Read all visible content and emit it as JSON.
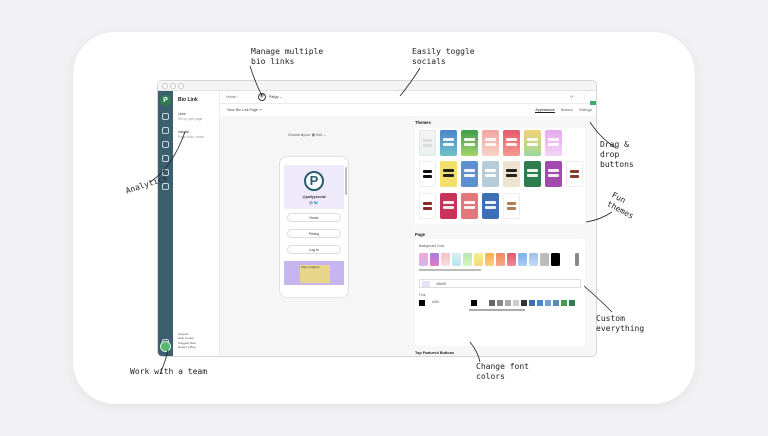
{
  "annotations": {
    "bio_links_l1": "Manage multiple",
    "bio_links_l2": "bio links",
    "socials_l1": "Easily toggle",
    "socials_l2": "socials",
    "analytics": "Analytics",
    "drag_l1": "Drag &",
    "drag_l2": "drop",
    "drag_l3": "buttons",
    "fun_l1": "Fun",
    "fun_l2": "themes",
    "custom_l1": "Custom",
    "custom_l2": "everything",
    "font_l1": "Change font",
    "font_l2": "colors",
    "team": "Work with a team"
  },
  "sidebar": {
    "brand": "Bio Link",
    "links_title": "Links",
    "links_sub": "Set up your page",
    "insights_title": "Insights",
    "insights_sub": "Page clicks, views",
    "footer": [
      "Support",
      "Help Center",
      "Suggest Idea",
      "Report a Bug"
    ]
  },
  "topbar": {
    "crumb": "Home /",
    "avatar": "P",
    "title": "Pallyy ⌄",
    "icons": "⟳ ⋮"
  },
  "subbar": {
    "view": "View Bio Link Page ↗",
    "tabs": [
      "Appearance",
      "Buttons",
      "Settings"
    ]
  },
  "preview": {
    "layout_label": "Choose layout",
    "layout_value": "▦ Grid ⌄",
    "logo": "P",
    "handle": "@pallyysocial",
    "socials": "◎ 🐦",
    "buttons": [
      "Home",
      "Pricing",
      "Log In"
    ],
    "promo": "Pallyy Instagram"
  },
  "themes": {
    "heading": "Themes"
  },
  "page": {
    "heading": "Page",
    "bg_label": "Background Color",
    "bg_hex": "#f3edff",
    "font_label": "Font",
    "font_hex": "#000"
  },
  "top_featured": "Top Featured Buttons",
  "colors": {
    "rail": "#3b5f6e",
    "accent": "#2f7d4e"
  }
}
